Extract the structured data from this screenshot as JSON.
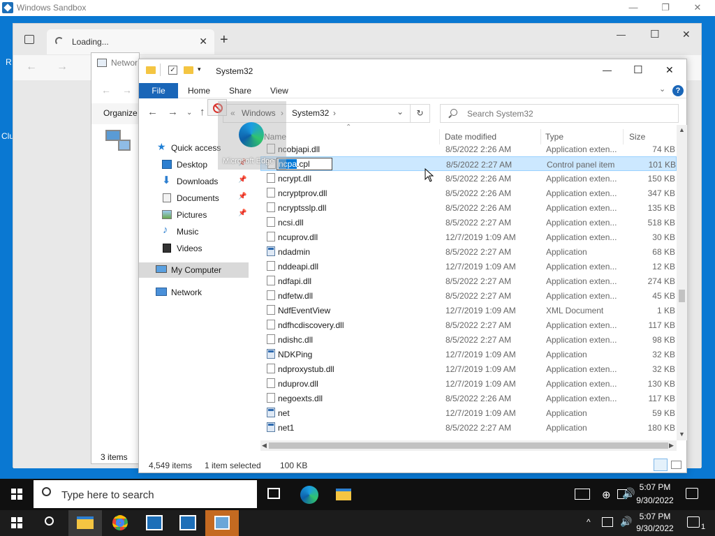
{
  "sandbox": {
    "title": "Windows Sandbox",
    "minimize": "—",
    "restore": "❐",
    "close": "✕"
  },
  "desktop": {
    "left_label_1": "R",
    "left_label_2": "Clu"
  },
  "edge": {
    "tab_label": "Loading...",
    "tab_close": "✕",
    "new_tab": "+",
    "minimize": "—",
    "maximize": "☐",
    "close": "✕"
  },
  "network_window": {
    "title": "Networ",
    "organize": "Organize",
    "items_count": "3 items"
  },
  "explorer": {
    "title": "System32",
    "controls": {
      "minimize": "—",
      "maximize": "☐",
      "close": "✕"
    },
    "ribbon": {
      "file": "File",
      "home": "Home",
      "share": "Share",
      "view": "View",
      "help": "?"
    },
    "address": {
      "prefix": "«",
      "crumb1": "Windows",
      "sep": "›",
      "crumb2": "System32",
      "chevron": "⌄",
      "refresh": "↻"
    },
    "search_placeholder": "Search System32",
    "columns": {
      "name": "Name",
      "date": "Date modified",
      "type": "Type",
      "size": "Size"
    },
    "nav": [
      {
        "label": "Quick access",
        "pinned": false
      },
      {
        "label": "Desktop",
        "pinned": true
      },
      {
        "label": "Downloads",
        "pinned": true
      },
      {
        "label": "Documents",
        "pinned": true
      },
      {
        "label": "Pictures",
        "pinned": true
      },
      {
        "label": "Music",
        "pinned": false
      },
      {
        "label": "Videos",
        "pinned": false
      },
      {
        "label": "My Computer",
        "pinned": false
      },
      {
        "label": "Network",
        "pinned": false
      }
    ],
    "rename": {
      "selected": "ncpa",
      "rest": ".cpl"
    },
    "files": [
      {
        "name": "ncobjapi.dll",
        "date": "8/5/2022 2:26 AM",
        "type": "Application exten...",
        "size": "74 KB",
        "kind": "dll"
      },
      {
        "name": "ncpa.cpl",
        "date": "8/5/2022 2:27 AM",
        "type": "Control panel item",
        "size": "101 KB",
        "kind": "cpl"
      },
      {
        "name": "ncrypt.dll",
        "date": "8/5/2022 2:26 AM",
        "type": "Application exten...",
        "size": "150 KB",
        "kind": "dll"
      },
      {
        "name": "ncryptprov.dll",
        "date": "8/5/2022 2:26 AM",
        "type": "Application exten...",
        "size": "347 KB",
        "kind": "dll"
      },
      {
        "name": "ncryptsslp.dll",
        "date": "8/5/2022 2:26 AM",
        "type": "Application exten...",
        "size": "135 KB",
        "kind": "dll"
      },
      {
        "name": "ncsi.dll",
        "date": "8/5/2022 2:27 AM",
        "type": "Application exten...",
        "size": "518 KB",
        "kind": "dll"
      },
      {
        "name": "ncuprov.dll",
        "date": "12/7/2019 1:09 AM",
        "type": "Application exten...",
        "size": "30 KB",
        "kind": "dll"
      },
      {
        "name": "ndadmin",
        "date": "8/5/2022 2:27 AM",
        "type": "Application",
        "size": "68 KB",
        "kind": "app"
      },
      {
        "name": "nddeapi.dll",
        "date": "12/7/2019 1:09 AM",
        "type": "Application exten...",
        "size": "12 KB",
        "kind": "dll"
      },
      {
        "name": "ndfapi.dll",
        "date": "8/5/2022 2:27 AM",
        "type": "Application exten...",
        "size": "274 KB",
        "kind": "dll"
      },
      {
        "name": "ndfetw.dll",
        "date": "8/5/2022 2:27 AM",
        "type": "Application exten...",
        "size": "45 KB",
        "kind": "dll"
      },
      {
        "name": "NdfEventView",
        "date": "12/7/2019 1:09 AM",
        "type": "XML Document",
        "size": "1 KB",
        "kind": "xml"
      },
      {
        "name": "ndfhcdiscovery.dll",
        "date": "8/5/2022 2:27 AM",
        "type": "Application exten...",
        "size": "117 KB",
        "kind": "dll"
      },
      {
        "name": "ndishc.dll",
        "date": "8/5/2022 2:27 AM",
        "type": "Application exten...",
        "size": "98 KB",
        "kind": "dll"
      },
      {
        "name": "NDKPing",
        "date": "12/7/2019 1:09 AM",
        "type": "Application",
        "size": "32 KB",
        "kind": "app"
      },
      {
        "name": "ndproxystub.dll",
        "date": "12/7/2019 1:09 AM",
        "type": "Application exten...",
        "size": "32 KB",
        "kind": "dll"
      },
      {
        "name": "nduprov.dll",
        "date": "12/7/2019 1:09 AM",
        "type": "Application exten...",
        "size": "130 KB",
        "kind": "dll"
      },
      {
        "name": "negoexts.dll",
        "date": "8/5/2022 2:26 AM",
        "type": "Application exten...",
        "size": "117 KB",
        "kind": "dll"
      },
      {
        "name": "net",
        "date": "12/7/2019 1:09 AM",
        "type": "Application",
        "size": "59 KB",
        "kind": "app"
      },
      {
        "name": "net1",
        "date": "8/5/2022 2:27 AM",
        "type": "Application",
        "size": "180 KB",
        "kind": "app"
      }
    ],
    "status": {
      "count": "4,549 items",
      "selected": "1 item selected",
      "size": "100 KB"
    }
  },
  "drag": {
    "label": "Microsoft Edge"
  },
  "taskbar_inner": {
    "search_placeholder": "Type here to search",
    "time": "5:07 PM",
    "date": "9/30/2022",
    "notif": "🗨"
  },
  "taskbar_outer": {
    "time": "5:07 PM",
    "date": "9/30/2022",
    "notif_count": "1",
    "caret": "^"
  },
  "colors": {
    "accent": "#1a66b8",
    "desktop": "#0a78d2",
    "selection": "#cce8ff"
  }
}
